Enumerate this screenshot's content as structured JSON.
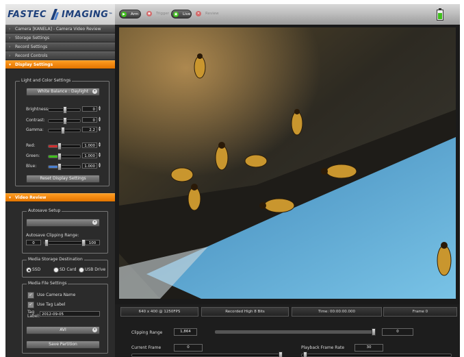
{
  "app": {
    "logo_left": "FASTEC",
    "logo_right": "IMAGING",
    "logo_tm": "™"
  },
  "toolbar": {
    "buttons": [
      {
        "label": "Arm",
        "icon": "play-icon",
        "active": true
      },
      {
        "label": "Trigger",
        "icon": "trigger-icon",
        "active": false
      },
      {
        "label": "Live",
        "icon": "live-icon",
        "active": true
      },
      {
        "label": "Review",
        "icon": "review-icon",
        "active": false
      }
    ],
    "battery_level": 0.85
  },
  "sidebar": {
    "sections": [
      "Camera [KANELA] - Camera Video Review",
      "Storage Settings",
      "Record Settings",
      "Record Controls",
      "Display Settings"
    ],
    "display": {
      "group_title": "Light and Color Settings",
      "white_balance": "White Balance : Daylight",
      "brightness_label": "Brightness:",
      "brightness_value": "0",
      "contrast_label": "Contrast:",
      "contrast_value": "0",
      "gamma_label": "Gamma:",
      "gamma_value": "2.2",
      "red_label": "Red:",
      "red_value": "1.000",
      "green_label": "Green:",
      "green_value": "1.000",
      "blue_label": "Blue:",
      "blue_value": "1.000",
      "reset_label": "Reset Display Settings"
    },
    "video_review": {
      "section": "Video Review",
      "autosave_title": "Autosave Setup",
      "clipping_label": "Autosave Clipping Range:",
      "clip_start": "0",
      "clip_end": "100",
      "media_title": "Media Storage Destination",
      "dest_ssd": "SSD",
      "dest_sd": "SD Card",
      "dest_usb": "USB Drive",
      "file_title": "Media File Settings",
      "use_camera_name": "Use Camera Name",
      "use_tag_label": "Use Tag Label",
      "tag_label": "Tag Label:",
      "tag_value": "2012-09-05",
      "format": "AVI",
      "save_label": "Save Partition"
    }
  },
  "status": {
    "resolution": "640 x 400 @ 1250FPS",
    "recorded": "Recorded High 8 Bits",
    "time": "Time: 00:00:00.000",
    "frame": "Frame 0",
    "clipping_label": "Clipping Range",
    "clipping_value": "1,864",
    "clipping_end": "0",
    "current_frame_label": "Current Frame",
    "current_frame_value": "0",
    "playback_label": "Playback Frame Rate",
    "playback_value": "30"
  },
  "colors": {
    "accent": "#f08300",
    "brand": "#1d3f7a",
    "green": "#3fbf1c",
    "red": "#d03030",
    "blue": "#4a7fd0"
  }
}
